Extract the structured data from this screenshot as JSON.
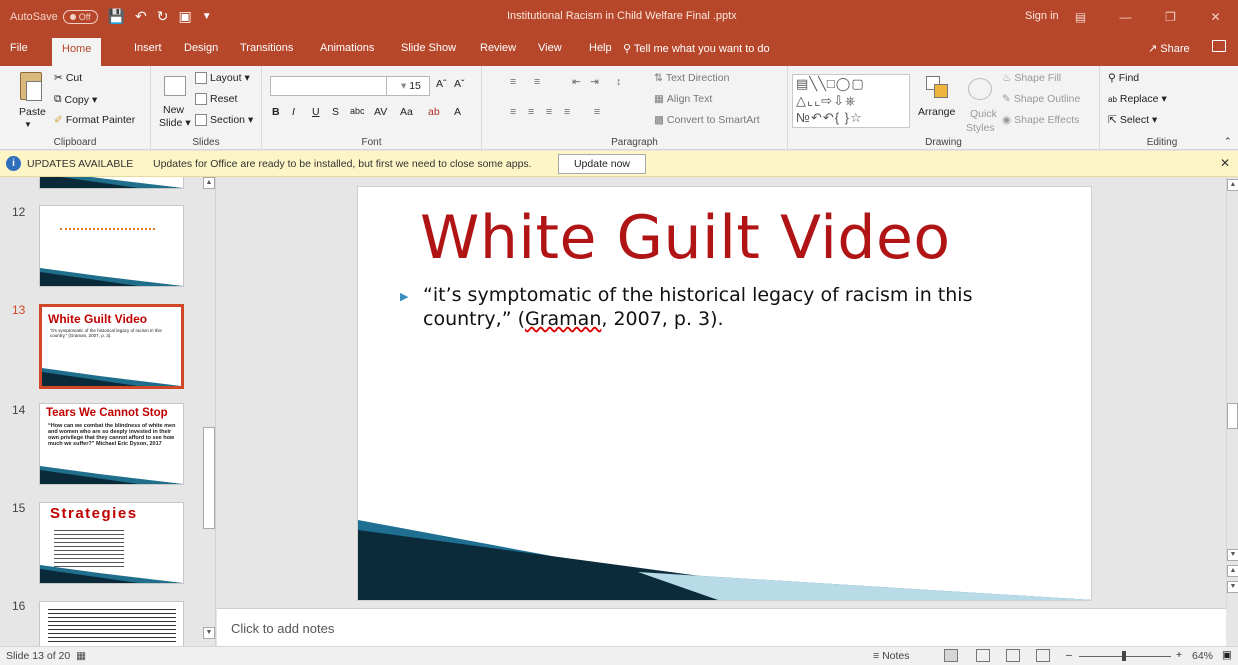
{
  "window": {
    "autosave_label": "AutoSave",
    "autosave_state": "Off",
    "title": "Institutional Racism in Child Welfare Final .pptx",
    "sign_in": "Sign in"
  },
  "tabs": [
    "File",
    "Home",
    "Insert",
    "Design",
    "Transitions",
    "Animations",
    "Slide Show",
    "Review",
    "View",
    "Help"
  ],
  "active_tab": "Home",
  "tell_me": "Tell me what you want to do",
  "share": "Share",
  "ribbon": {
    "clipboard": {
      "paste": "Paste",
      "cut": "Cut",
      "copy": "Copy",
      "format_painter": "Format Painter",
      "label": "Clipboard"
    },
    "slides": {
      "new_slide": "New",
      "new_slide2": "Slide",
      "layout": "Layout",
      "reset": "Reset",
      "section": "Section",
      "label": "Slides"
    },
    "font": {
      "font_name": "",
      "font_size": "15",
      "label": "Font"
    },
    "paragraph": {
      "text_direction": "Text Direction",
      "align_text": "Align Text",
      "convert_smartart": "Convert to SmartArt",
      "label": "Paragraph"
    },
    "drawing": {
      "arrange": "Arrange",
      "quick_styles": "Quick",
      "quick_styles2": "Styles",
      "shape_fill": "Shape Fill",
      "shape_outline": "Shape Outline",
      "shape_effects": "Shape Effects",
      "label": "Drawing"
    },
    "editing": {
      "find": "Find",
      "replace": "Replace",
      "select": "Select",
      "label": "Editing"
    }
  },
  "update_bar": {
    "title": "UPDATES AVAILABLE",
    "message": "Updates for Office are ready to be installed, but first we need to close some apps.",
    "button": "Update now"
  },
  "thumbnails": [
    {
      "number": "12",
      "title": "",
      "body": ""
    },
    {
      "number": "13",
      "title": "White Guilt Video",
      "body": "“it’s symptomatic of the historical legacy of racism in this country,” (Graman, 2007, p. 3)."
    },
    {
      "number": "14",
      "title": "Tears We Cannot Stop",
      "body": "“How can we combat the blindness of white men and women who are so deeply invested in their own privilege that they cannot afford to see how much we suffer?” Michael Eric Dyson, 2017"
    },
    {
      "number": "15",
      "title": "Strategies",
      "body": ""
    },
    {
      "number": "16",
      "title": "",
      "body": ""
    }
  ],
  "slide": {
    "title": "White Guilt Video",
    "bullet_pre": "“it’s symptomatic of the historical legacy of racism in this country,” (",
    "bullet_link": "Graman",
    "bullet_post": ", 2007, p. 3)."
  },
  "notes_placeholder": "Click to add notes",
  "status": {
    "slide_counter": "Slide 13 of 20",
    "notes": "Notes",
    "zoom": "64%"
  },
  "colors": {
    "accent": "#b7472a",
    "title_red": "#b01414",
    "selection": "#d24726"
  }
}
